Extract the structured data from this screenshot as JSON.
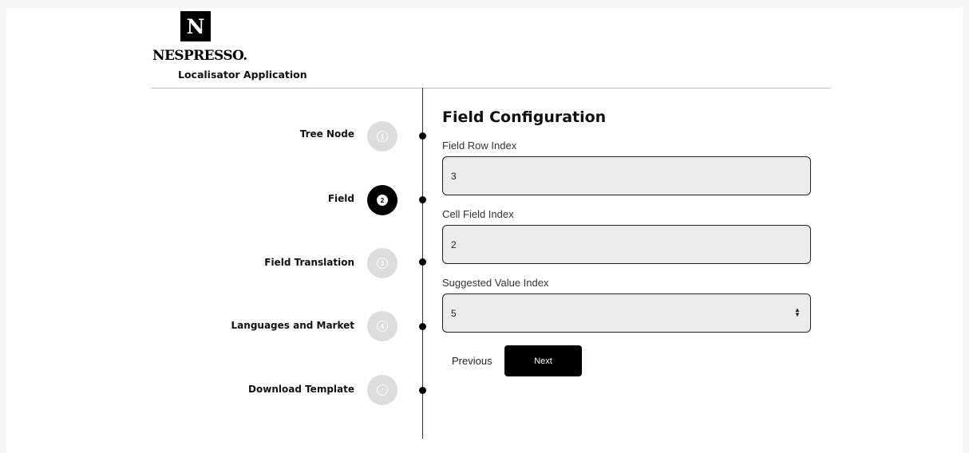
{
  "header": {
    "logo_letter": "N",
    "brand": "NESPRESSO.",
    "app_title": "Localisator Application"
  },
  "steps": [
    {
      "label": "Tree Node",
      "number": "1",
      "state": "done"
    },
    {
      "label": "Field",
      "number": "2",
      "state": "active"
    },
    {
      "label": "Field Translation",
      "number": "3",
      "state": "pending"
    },
    {
      "label": "Languages and Market",
      "number": "4",
      "state": "pending"
    },
    {
      "label": "Download Template",
      "number": "✓",
      "state": "pending"
    }
  ],
  "form": {
    "title": "Field Configuration",
    "fields": [
      {
        "label": "Field Row Index",
        "value": "3"
      },
      {
        "label": "Cell Field Index",
        "value": "2"
      },
      {
        "label": "Suggested Value Index",
        "value": "5"
      }
    ],
    "previous_label": "Previous",
    "next_label": "Next"
  },
  "colors": {
    "accent": "#000000",
    "step_inactive": "#dcdcdc",
    "input_bg": "#ececec"
  }
}
